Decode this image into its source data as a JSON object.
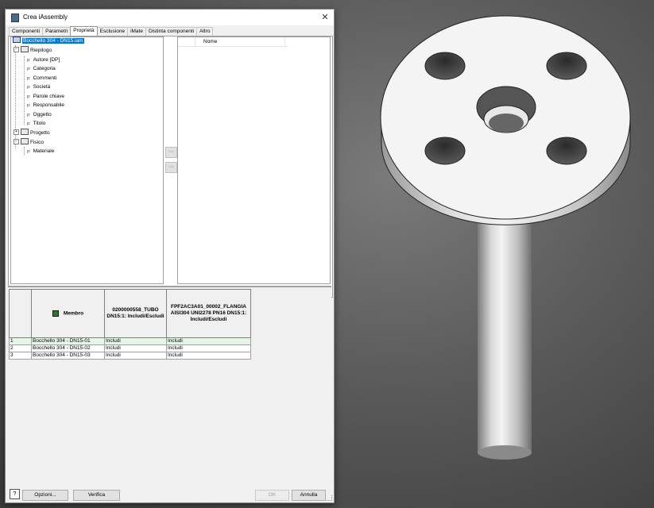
{
  "window": {
    "title": "Crea iAssembly",
    "close_glyph": "✕"
  },
  "tabs": [
    {
      "label": "Componenti",
      "active": false
    },
    {
      "label": "Parametri",
      "active": false
    },
    {
      "label": "Proprietà",
      "active": true
    },
    {
      "label": "Esclusione",
      "active": false
    },
    {
      "label": "iMate",
      "active": false
    },
    {
      "label": "Distinta componenti",
      "active": false
    },
    {
      "label": "Altro",
      "active": false
    }
  ],
  "tree": {
    "root": "Bocchello 304 - DN15.iam",
    "groups": [
      {
        "label": "Riepilogo",
        "expander": "−",
        "items": [
          "Autore [DP]",
          "Categoria",
          "Commenti",
          "Società",
          "Parole chiave",
          "Responsabile",
          "Oggetto",
          "Titolo"
        ]
      },
      {
        "label": "Progetto",
        "expander": "+",
        "items": []
      },
      {
        "label": "Fisico",
        "expander": "−",
        "items": [
          "Materiale"
        ]
      }
    ],
    "prop_glyph": "p:"
  },
  "move_buttons": {
    "add": ">>",
    "remove": "<<"
  },
  "list": {
    "column_header": "Nome"
  },
  "grid": {
    "headers": [
      "",
      "Membro",
      "0200000558_TUBO DN15:1: Includi/Escludi",
      "FPF2AC3A01_00002_FLANGIA AISI304 UNI2278 PN16 DN15:1: Includi/Escludi"
    ],
    "rows": [
      {
        "num": "1",
        "member": "Bocchello 304 - DN15-01",
        "c1": "Includi",
        "c2": "Includi"
      },
      {
        "num": "2",
        "member": "Bocchello 304 - DN15-02",
        "c1": "Includi",
        "c2": "Includi"
      },
      {
        "num": "3",
        "member": "Bocchello 304 - DN15-03",
        "c1": "Includi",
        "c2": "Includi"
      }
    ]
  },
  "footer": {
    "help": "?",
    "options": "Opzioni...",
    "verify": "Verifica",
    "ok": "OK",
    "cancel": "Annulla"
  }
}
